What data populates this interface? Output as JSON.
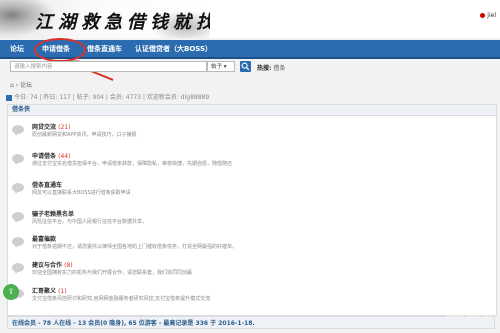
{
  "banner": {
    "logo_text": "江湖救急借钱就找",
    "user_label": "jiel"
  },
  "nav": {
    "items": [
      "论坛",
      "申请借条",
      "借条直通车",
      "认证借贷者（大BOSS）"
    ]
  },
  "search": {
    "placeholder": "请输入搜索内容",
    "scope": "帖子",
    "hot_label": "热搜:",
    "hot_item": "借条"
  },
  "breadcrumb": {
    "home_icon": "home-icon",
    "label": "论坛"
  },
  "stats": {
    "text": "今日: 74 | 昨日: 117 | 帖子: 904 | 会员: 4773 | 欢迎新会员: dlg88889"
  },
  "section": {
    "title": "借条侠"
  },
  "forums": [
    {
      "title": "网贷交流",
      "count": "(21)",
      "desc": "原创最新网贷和APP资讯，申请技巧，口子播报"
    },
    {
      "title": "申请借条",
      "count": "(44)",
      "desc": "通过支付宝实名借贷担保平台，申请借条获款，保障隐私，审核快捷，先期自愿，随借随还"
    },
    {
      "title": "借条直通车",
      "count": "",
      "desc": "网友可以直接联系大BOSS进行借条获取申请"
    },
    {
      "title": "骗子老赖黑名单",
      "count": "",
      "desc": "风险征信平台，与中国人民银行征信平台数据共享。"
    },
    {
      "title": "最富催款",
      "count": "",
      "desc": "对于借条逾期不还，请您委托以律师全国各地的上门催收借条债务，打造全网最强的好催单。"
    },
    {
      "title": "建议与合作",
      "count": "(8)",
      "desc": "欢迎全国拥有实力的机构与我们开展合作，请您联系套，我们协同同创赢"
    },
    {
      "title": "汇哥聚义",
      "count": "(1)",
      "desc": "支付宝借条风控研讨和研究,官网网金融服务者研究风控,支付宝借条提升模式交流"
    }
  ],
  "online": {
    "text": "在线会员 - 78 人在线 - 13 会员(0 隐身), 65 位游客 - 最高记录是 336 于 2016-1-18."
  },
  "watermark": {
    "main": "Baidu 经验",
    "sub": "jingyan.baidu.com"
  },
  "share_icon": "share-icon",
  "colors": {
    "nav": "#2b6cb0",
    "highlight": "#d9342b",
    "accent": "#2b5c8a"
  }
}
